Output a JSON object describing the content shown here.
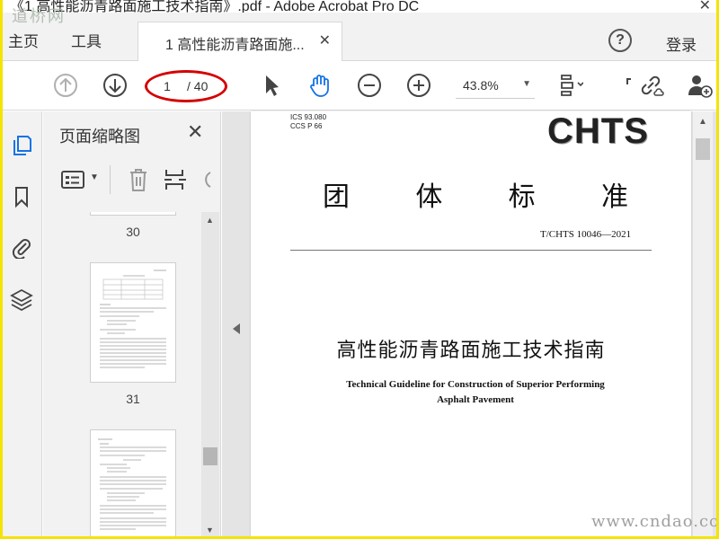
{
  "window": {
    "title": "《1 高性能沥青路面施工技术指南》.pdf - Adobe Acrobat Pro DC",
    "close": "✕"
  },
  "menubar": {
    "home": "主页",
    "tools": "工具",
    "tab_label": "1 高性能沥青路面施...",
    "tab_close": "✕",
    "help": "?",
    "login": "登录"
  },
  "toolbar": {
    "page_current": "1",
    "page_total": "/ 40",
    "zoom": "43.8%",
    "zoom_caret": "▼"
  },
  "thumbnails": {
    "title": "页面缩略图",
    "close": "✕",
    "pages": [
      {
        "label": "30"
      },
      {
        "label": "31"
      }
    ]
  },
  "document": {
    "ics": "ICS 93.080",
    "ccs": "CCS P 66",
    "logo": "CHTS",
    "standard_type": [
      "团",
      "体",
      "标",
      "准"
    ],
    "standard_number": "T/CHTS 10046—2021",
    "title_cn": "高性能沥青路面施工技术指南",
    "title_en_line1": "Technical Guideline for Construction of Superior Performing",
    "title_en_line2": "Asphalt Pavement"
  },
  "watermarks": {
    "top": "道桥网",
    "bottom": "www.cndao.com"
  },
  "colors": {
    "annotation_circle": "#d40000",
    "page_bg": "#ffffff",
    "chrome_bg": "#f2f2f2",
    "frame_border": "#f5e300"
  }
}
